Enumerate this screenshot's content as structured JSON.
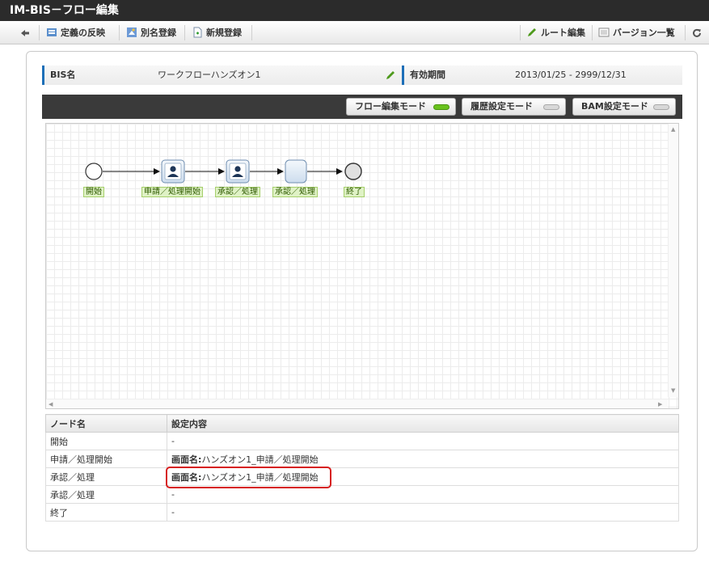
{
  "window": {
    "title": "IM-BIS－フロー編集"
  },
  "toolbar": {
    "back_label": "",
    "reflect_label": "定義の反映",
    "alias_label": "別名登録",
    "new_label": "新規登録",
    "route_edit_label": "ルート編集",
    "version_list_label": "バージョン一覧"
  },
  "info": {
    "bis_name_label": "BIS名",
    "bis_name_value": "ワークフローハンズオン1",
    "period_label": "有効期間",
    "period_value": "2013/01/25 - 2999/12/31"
  },
  "modes": [
    {
      "label": "フロー編集モード",
      "active": true
    },
    {
      "label": "履歴設定モード",
      "active": false
    },
    {
      "label": "BAM設定モード",
      "active": false
    }
  ],
  "flow": {
    "nodes": [
      {
        "type": "start",
        "label": "開始"
      },
      {
        "type": "user",
        "label": "申請／処理開始"
      },
      {
        "type": "user",
        "label": "承認／処理"
      },
      {
        "type": "blank",
        "label": "承認／処理"
      },
      {
        "type": "end",
        "label": "終了"
      }
    ]
  },
  "table": {
    "headers": [
      "ノード名",
      "設定内容"
    ],
    "rows": [
      {
        "node": "開始",
        "prefix": "",
        "setting": "-"
      },
      {
        "node": "申請／処理開始",
        "prefix": "画面名:",
        "setting": "ハンズオン1_申請／処理開始"
      },
      {
        "node": "承認／処理",
        "prefix": "画面名:",
        "setting": "ハンズオン1_申請／処理開始"
      },
      {
        "node": "承認／処理",
        "prefix": "",
        "setting": "-"
      },
      {
        "node": "終了",
        "prefix": "",
        "setting": "-"
      }
    ]
  },
  "colors": {
    "accent": "#1d6fb8",
    "highlight": "#d61d1d",
    "mode_on": "#69c21d"
  }
}
